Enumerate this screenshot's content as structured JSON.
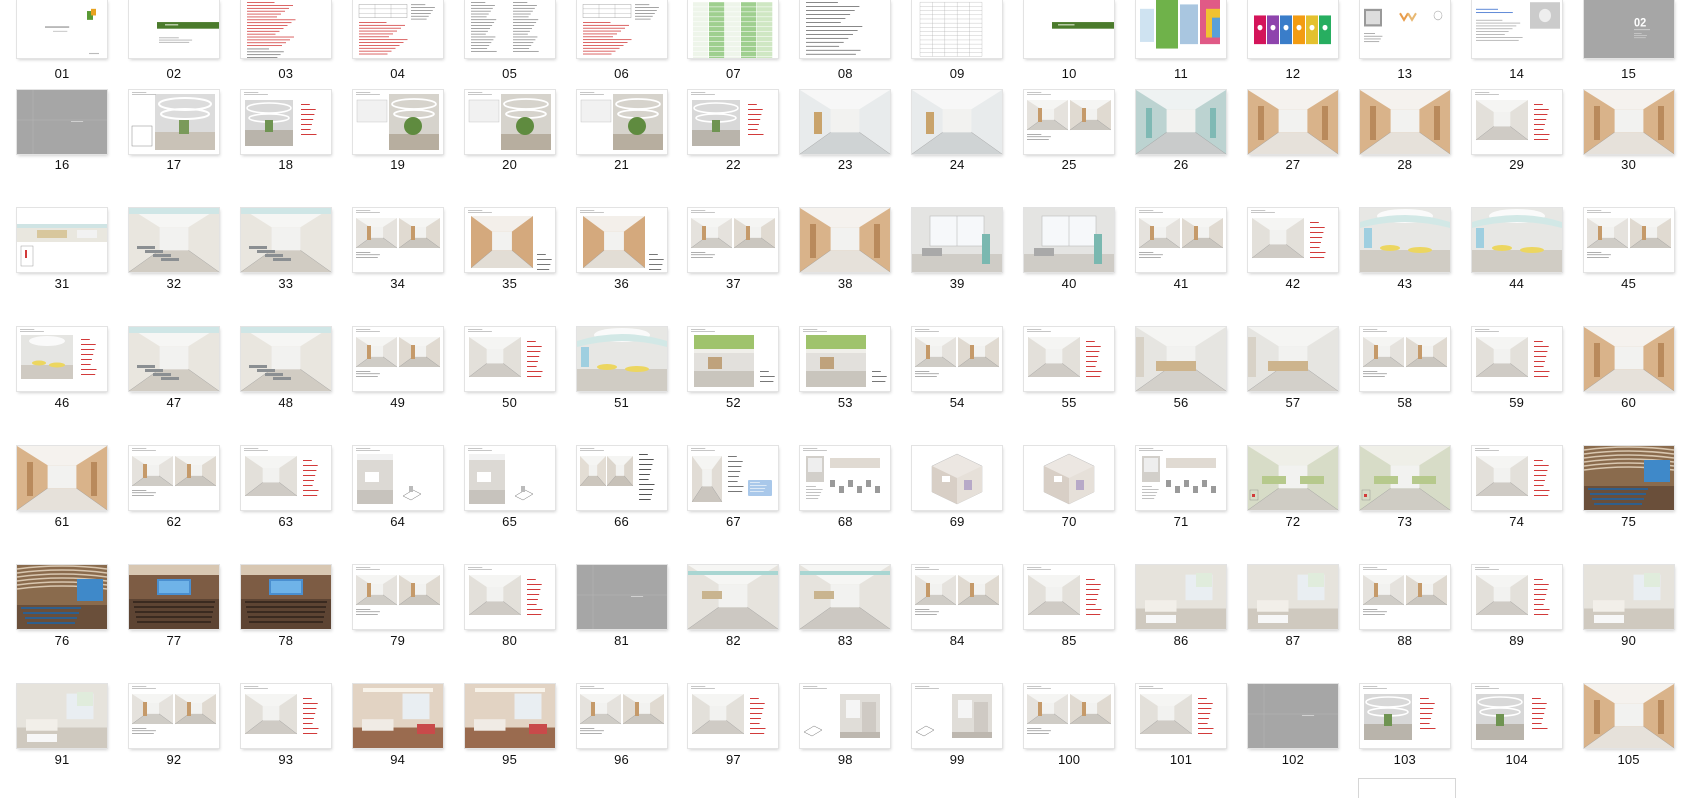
{
  "thumbnail_view": {
    "slides": [
      {
        "label": "01",
        "kind": "cover"
      },
      {
        "label": "02",
        "kind": "section-green"
      },
      {
        "label": "03",
        "kind": "text-red"
      },
      {
        "label": "04",
        "kind": "table-text"
      },
      {
        "label": "05",
        "kind": "text-columns"
      },
      {
        "label": "06",
        "kind": "table-text"
      },
      {
        "label": "07",
        "kind": "table-green"
      },
      {
        "label": "08",
        "kind": "text-list"
      },
      {
        "label": "09",
        "kind": "table-grid"
      },
      {
        "label": "10",
        "kind": "section-green-right"
      },
      {
        "label": "11",
        "kind": "moodboard"
      },
      {
        "label": "12",
        "kind": "color-tiles"
      },
      {
        "label": "13",
        "kind": "logo-board"
      },
      {
        "label": "14",
        "kind": "text-image"
      },
      {
        "label": "15",
        "kind": "gray-number",
        "caption_text": "02"
      },
      {
        "label": "16",
        "kind": "gray-divider"
      },
      {
        "label": "17",
        "kind": "atrium"
      },
      {
        "label": "18",
        "kind": "atrium-notes"
      },
      {
        "label": "19",
        "kind": "atrium-plant"
      },
      {
        "label": "20",
        "kind": "atrium-plant"
      },
      {
        "label": "21",
        "kind": "atrium-plant"
      },
      {
        "label": "22",
        "kind": "atrium-notes"
      },
      {
        "label": "23",
        "kind": "corridor-white"
      },
      {
        "label": "24",
        "kind": "corridor-white"
      },
      {
        "label": "25",
        "kind": "dual-renders"
      },
      {
        "label": "26",
        "kind": "corridor-teal"
      },
      {
        "label": "27",
        "kind": "corridor-wood"
      },
      {
        "label": "28",
        "kind": "corridor-wood"
      },
      {
        "label": "29",
        "kind": "render-notes"
      },
      {
        "label": "30",
        "kind": "corridor-wood"
      },
      {
        "label": "31",
        "kind": "wide-strip"
      },
      {
        "label": "32",
        "kind": "waiting-hall"
      },
      {
        "label": "33",
        "kind": "waiting-hall"
      },
      {
        "label": "34",
        "kind": "dual-renders"
      },
      {
        "label": "35",
        "kind": "corridor-wood-notes"
      },
      {
        "label": "36",
        "kind": "corridor-wood-notes"
      },
      {
        "label": "37",
        "kind": "dual-renders"
      },
      {
        "label": "38",
        "kind": "corridor-wood"
      },
      {
        "label": "39",
        "kind": "room-window"
      },
      {
        "label": "40",
        "kind": "room-window"
      },
      {
        "label": "41",
        "kind": "dual-renders"
      },
      {
        "label": "42",
        "kind": "render-notes"
      },
      {
        "label": "43",
        "kind": "lounge-yellow"
      },
      {
        "label": "44",
        "kind": "lounge-yellow"
      },
      {
        "label": "45",
        "kind": "dual-renders"
      },
      {
        "label": "46",
        "kind": "lounge-notes"
      },
      {
        "label": "47",
        "kind": "waiting-hall"
      },
      {
        "label": "48",
        "kind": "waiting-hall"
      },
      {
        "label": "49",
        "kind": "dual-renders"
      },
      {
        "label": "50",
        "kind": "render-notes"
      },
      {
        "label": "51",
        "kind": "lounge-yellow"
      },
      {
        "label": "52",
        "kind": "green-ceiling"
      },
      {
        "label": "53",
        "kind": "green-ceiling"
      },
      {
        "label": "54",
        "kind": "dual-renders"
      },
      {
        "label": "55",
        "kind": "render-notes"
      },
      {
        "label": "56",
        "kind": "reception"
      },
      {
        "label": "57",
        "kind": "reception"
      },
      {
        "label": "58",
        "kind": "dual-renders"
      },
      {
        "label": "59",
        "kind": "render-notes"
      },
      {
        "label": "60",
        "kind": "corridor-wood"
      },
      {
        "label": "61",
        "kind": "corridor-wood"
      },
      {
        "label": "62",
        "kind": "dual-renders"
      },
      {
        "label": "63",
        "kind": "render-notes"
      },
      {
        "label": "64",
        "kind": "bath-plan"
      },
      {
        "label": "65",
        "kind": "bath-plan"
      },
      {
        "label": "66",
        "kind": "dual-renders-notes"
      },
      {
        "label": "67",
        "kind": "render-notes-blue"
      },
      {
        "label": "68",
        "kind": "fixtures"
      },
      {
        "label": "69",
        "kind": "axon-room"
      },
      {
        "label": "70",
        "kind": "axon-room"
      },
      {
        "label": "71",
        "kind": "fixtures"
      },
      {
        "label": "72",
        "kind": "green-room"
      },
      {
        "label": "73",
        "kind": "green-room"
      },
      {
        "label": "74",
        "kind": "render-notes"
      },
      {
        "label": "75",
        "kind": "auditorium"
      },
      {
        "label": "76",
        "kind": "auditorium"
      },
      {
        "label": "77",
        "kind": "theater"
      },
      {
        "label": "78",
        "kind": "theater"
      },
      {
        "label": "79",
        "kind": "dual-renders"
      },
      {
        "label": "80",
        "kind": "render-notes"
      },
      {
        "label": "81",
        "kind": "gray-divider"
      },
      {
        "label": "82",
        "kind": "ward-corridor"
      },
      {
        "label": "83",
        "kind": "ward-corridor"
      },
      {
        "label": "84",
        "kind": "dual-renders"
      },
      {
        "label": "85",
        "kind": "render-notes"
      },
      {
        "label": "86",
        "kind": "ward-room"
      },
      {
        "label": "87",
        "kind": "ward-room"
      },
      {
        "label": "88",
        "kind": "dual-renders"
      },
      {
        "label": "89",
        "kind": "render-notes"
      },
      {
        "label": "90",
        "kind": "ward-room"
      },
      {
        "label": "91",
        "kind": "ward-room"
      },
      {
        "label": "92",
        "kind": "dual-renders"
      },
      {
        "label": "93",
        "kind": "render-notes"
      },
      {
        "label": "94",
        "kind": "vip-room"
      },
      {
        "label": "95",
        "kind": "vip-room"
      },
      {
        "label": "96",
        "kind": "dual-renders"
      },
      {
        "label": "97",
        "kind": "render-notes"
      },
      {
        "label": "98",
        "kind": "bath-single"
      },
      {
        "label": "99",
        "kind": "bath-single"
      },
      {
        "label": "100",
        "kind": "dual-renders"
      },
      {
        "label": "101",
        "kind": "render-notes"
      },
      {
        "label": "102",
        "kind": "gray-divider"
      },
      {
        "label": "103",
        "kind": "atrium-notes"
      },
      {
        "label": "104",
        "kind": "atrium-notes"
      },
      {
        "label": "105",
        "kind": "corridor-wood"
      }
    ]
  },
  "colors": {
    "window_background": "#ffffff",
    "caption_text": "#111111",
    "divider_gray": "#a6a6a6",
    "brand_green": "#4b7b2c",
    "note_red": "#d23a3a"
  }
}
